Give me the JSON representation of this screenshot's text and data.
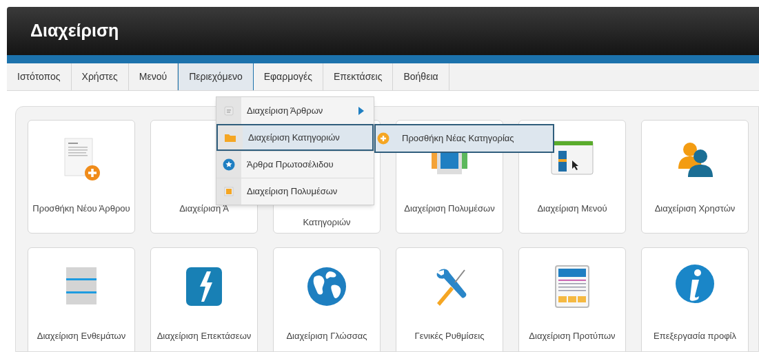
{
  "header": {
    "title": "Διαχείριση"
  },
  "tabs": [
    {
      "label": "Ιστότοπος",
      "selected": false
    },
    {
      "label": "Χρήστες",
      "selected": false
    },
    {
      "label": "Μενού",
      "selected": false
    },
    {
      "label": "Περιεχόμενο",
      "selected": true
    },
    {
      "label": "Εφαρμογές",
      "selected": false
    },
    {
      "label": "Επεκτάσεις",
      "selected": false
    },
    {
      "label": "Βοήθεια",
      "selected": false
    }
  ],
  "dropdown": {
    "items": [
      {
        "label": "Διαχείριση Άρθρων",
        "kind": "article",
        "submenu": true,
        "selected": false
      },
      {
        "label": "Διαχείριση Κατηγοριών",
        "kind": "folder",
        "submenu": false,
        "selected": true
      },
      {
        "label": "Άρθρα Πρωτοσέλιδου",
        "kind": "star",
        "submenu": false,
        "selected": false
      },
      {
        "label": "Διαχείριση Πολυμέσων",
        "kind": "media",
        "submenu": false,
        "selected": false
      }
    ],
    "submenu": [
      {
        "label": "Προσθήκη Νέας Κατηγορίας",
        "kind": "add",
        "selected": true
      }
    ]
  },
  "cards": [
    {
      "label": "Προσθήκη Νέου Άρθρου",
      "kind": "article-add"
    },
    {
      "label": "Διαχείριση Ά",
      "kind": "covered"
    },
    {
      "label": "Κατηγοριών",
      "kind": "covered",
      "first_line_covered": true
    },
    {
      "label": "Διαχείριση Πολυμέσων",
      "kind": "media"
    },
    {
      "label": "Διαχείριση Μενού",
      "kind": "menu"
    },
    {
      "label": "Διαχείριση Χρηστών",
      "kind": "users"
    },
    {
      "label": "Διαχείριση Ενθεμάτων",
      "kind": "modules"
    },
    {
      "label": "Διαχείριση Επεκτάσεων",
      "kind": "extensions"
    },
    {
      "label": "Διαχείριση Γλώσσας",
      "kind": "language"
    },
    {
      "label": "Γενικές Ρυθμίσεις",
      "kind": "settings"
    },
    {
      "label": "Διαχείριση Προτύπων",
      "kind": "templates"
    },
    {
      "label": "Επεξεργασία προφίλ",
      "kind": "info"
    }
  ]
}
